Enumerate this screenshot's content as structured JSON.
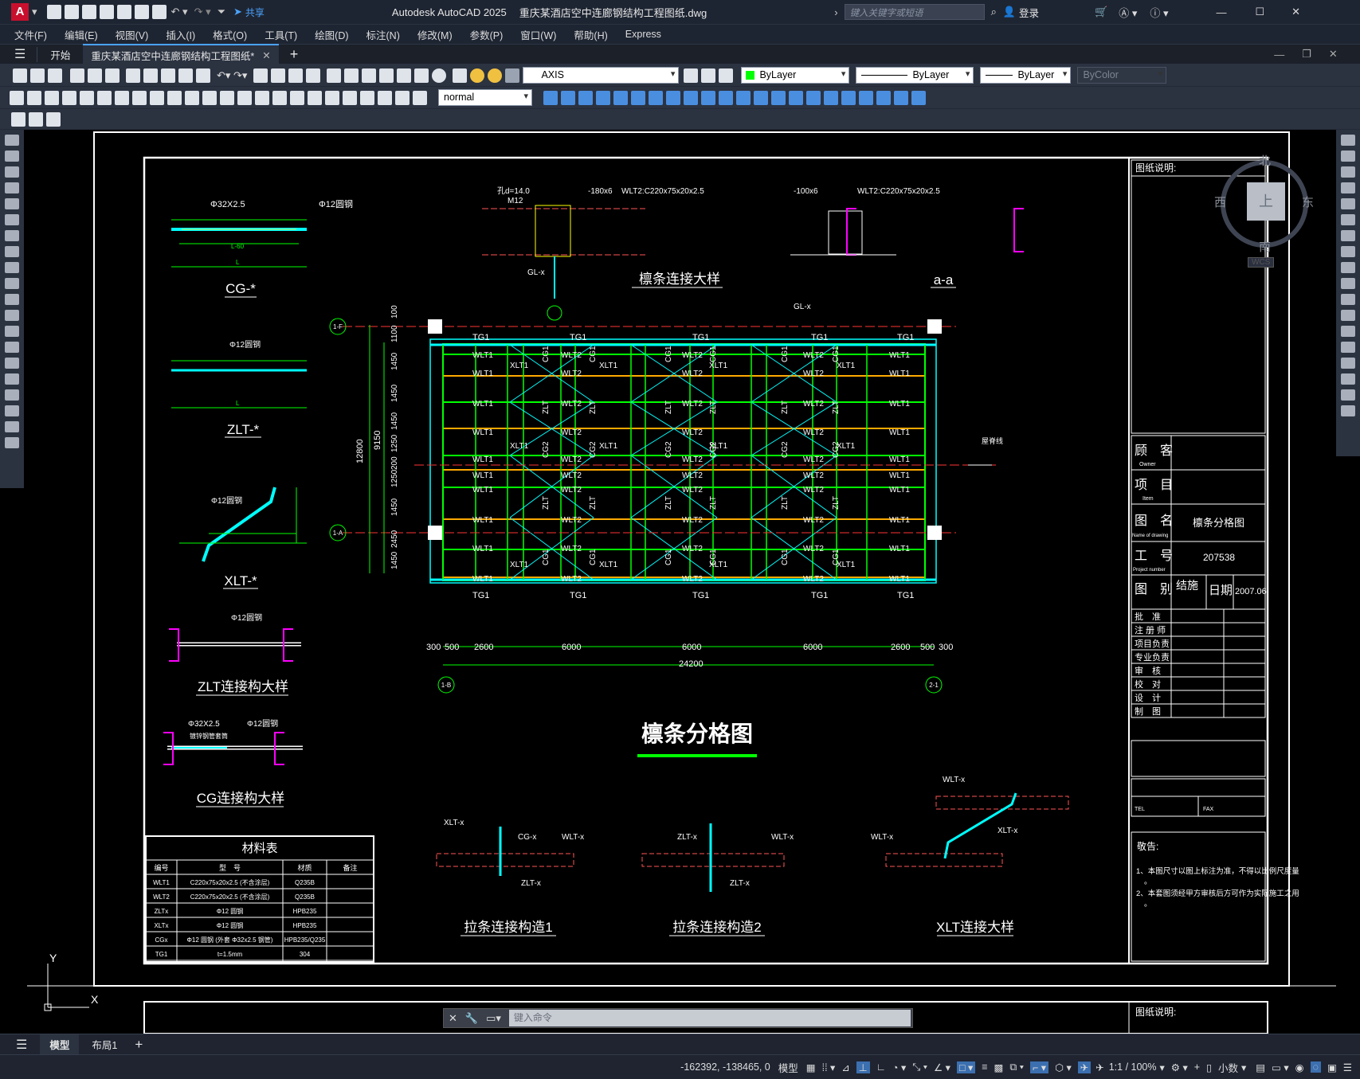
{
  "app": {
    "title_product": "Autodesk AutoCAD 2025",
    "title_file": "重庆某酒店空中连廊钢结构工程图纸.dwg",
    "share": "共享",
    "search_placeholder": "键入关键字或短语",
    "login": "登录"
  },
  "menu": [
    "文件(F)",
    "编辑(E)",
    "视图(V)",
    "插入(I)",
    "格式(O)",
    "工具(T)",
    "绘图(D)",
    "标注(N)",
    "修改(M)",
    "参数(P)",
    "窗口(W)",
    "帮助(H)",
    "Express"
  ],
  "tabs": {
    "start": "开始",
    "doc": "重庆某酒店空中连廊钢结构工程图纸*"
  },
  "toolbar": {
    "layer": "AXIS",
    "color": "ByLayer",
    "linetype": "ByLayer",
    "lineweight": "ByLayer",
    "plotstyle": "ByColor",
    "textstyle": "normal"
  },
  "viewcube": {
    "north": "北",
    "south": "南",
    "east": "东",
    "west": "西",
    "top": "上",
    "wcs": "WCS"
  },
  "drawing": {
    "main_title": "檩条分格图",
    "details": {
      "cg": "CG-*",
      "zlt": "ZLT-*",
      "xlt": "XLT-*",
      "zlt_conn": "ZLT连接构大样",
      "cg_conn": "CG连接构大样",
      "purlin_detail": "檩条连接大样",
      "section_aa": "a-a",
      "brace1": "拉条连接构造1",
      "brace2": "拉条连接构造2",
      "xlt_conn": "XLT连接大样"
    },
    "labels": {
      "pipe32": "Φ32X2.5",
      "bar12": "Φ12圆钢",
      "L60": "L-60",
      "L": "L",
      "d14": "孔d=14.0",
      "M12": "M12",
      "plate180": "-180x6",
      "plate100": "-100x6",
      "wlt2": "WLT2:C220x75x20x2.5",
      "glx": "GL-x",
      "ridge": "屋脊线",
      "sleeve": "镀锌钢管套筒",
      "dim_total": "24200",
      "dims_x": [
        "300",
        "500",
        "2600",
        "6000",
        "6000",
        "6000",
        "2600",
        "500",
        "300"
      ],
      "dims_y_total": "12800",
      "dims_y_mid": "9150",
      "dims_y": [
        "100",
        "1100",
        "1450",
        "1450",
        "1450",
        "1250",
        "200",
        "1250",
        "1450",
        "1450",
        "2450",
        "1450"
      ],
      "axis_top": "1-F",
      "axis_mid": "1-A",
      "axis_left": "1-B",
      "axis_right": "2-1",
      "tg": "TG1",
      "wlt1": "WLT1",
      "wlt2s": "WLT2",
      "xlt1": "XLT1",
      "zlt": "ZLT",
      "cg1": "CG1",
      "cg2": "CG2",
      "cgx": "CG-x",
      "wltx": "WLT-x",
      "zltx": "ZLT-x",
      "xltx": "XLT-x"
    },
    "material_table": {
      "title": "材料表",
      "headers": [
        "编号",
        "型　号",
        "材质",
        "备注"
      ],
      "rows": [
        [
          "WLT1",
          "C220x75x20x2.5 (不含涂层)",
          "Q235B",
          ""
        ],
        [
          "WLT2",
          "C220x75x20x2.5 (不含涂层)",
          "Q235B",
          ""
        ],
        [
          "ZLTx",
          "Φ12 圆钢",
          "HPB235",
          ""
        ],
        [
          "XLTx",
          "Φ12 圆钢",
          "HPB235",
          ""
        ],
        [
          "CGx",
          "Φ12 圆钢 (外套 Φ32x2.5 钢管)",
          "HPB235/Q235",
          ""
        ],
        [
          "TG1",
          "t=1.5mm",
          "304",
          ""
        ]
      ]
    },
    "titleblock": {
      "heading": "图纸说明:",
      "owner": "顾　客",
      "owner_en": "Owner",
      "item": "项　目",
      "item_en": "Item",
      "drawing_name": "图　名",
      "drawing_name_en": "Name of drawing",
      "drawing_name_val": "檩条分格图",
      "project_no": "工　号",
      "project_no_en": "Project number",
      "project_no_val": "207538",
      "category": "图　别",
      "category_val": "结施",
      "date": "日期",
      "date_val": "2007.06",
      "sign_rows": [
        "批　准",
        "注 册 师",
        "项目负责",
        "专业负责",
        "审　核",
        "校　对",
        "设　计",
        "制　图"
      ],
      "tel": "TEL",
      "fax": "FAX",
      "notes_title": "敬告:",
      "notes": [
        "1、本图尺寸以图上标注为准，不得以比例尺度量。",
        "2、本套图须经甲方审核后方可作为实际施工之用。"
      ],
      "heading2": "图纸说明:"
    }
  },
  "command": {
    "placeholder": "键入命令"
  },
  "layout_tabs": [
    "模型",
    "布局1"
  ],
  "status": {
    "coords": "-162392, -138465, 0",
    "model": "模型",
    "scale": "1:1 / 100%",
    "units": "小数"
  }
}
